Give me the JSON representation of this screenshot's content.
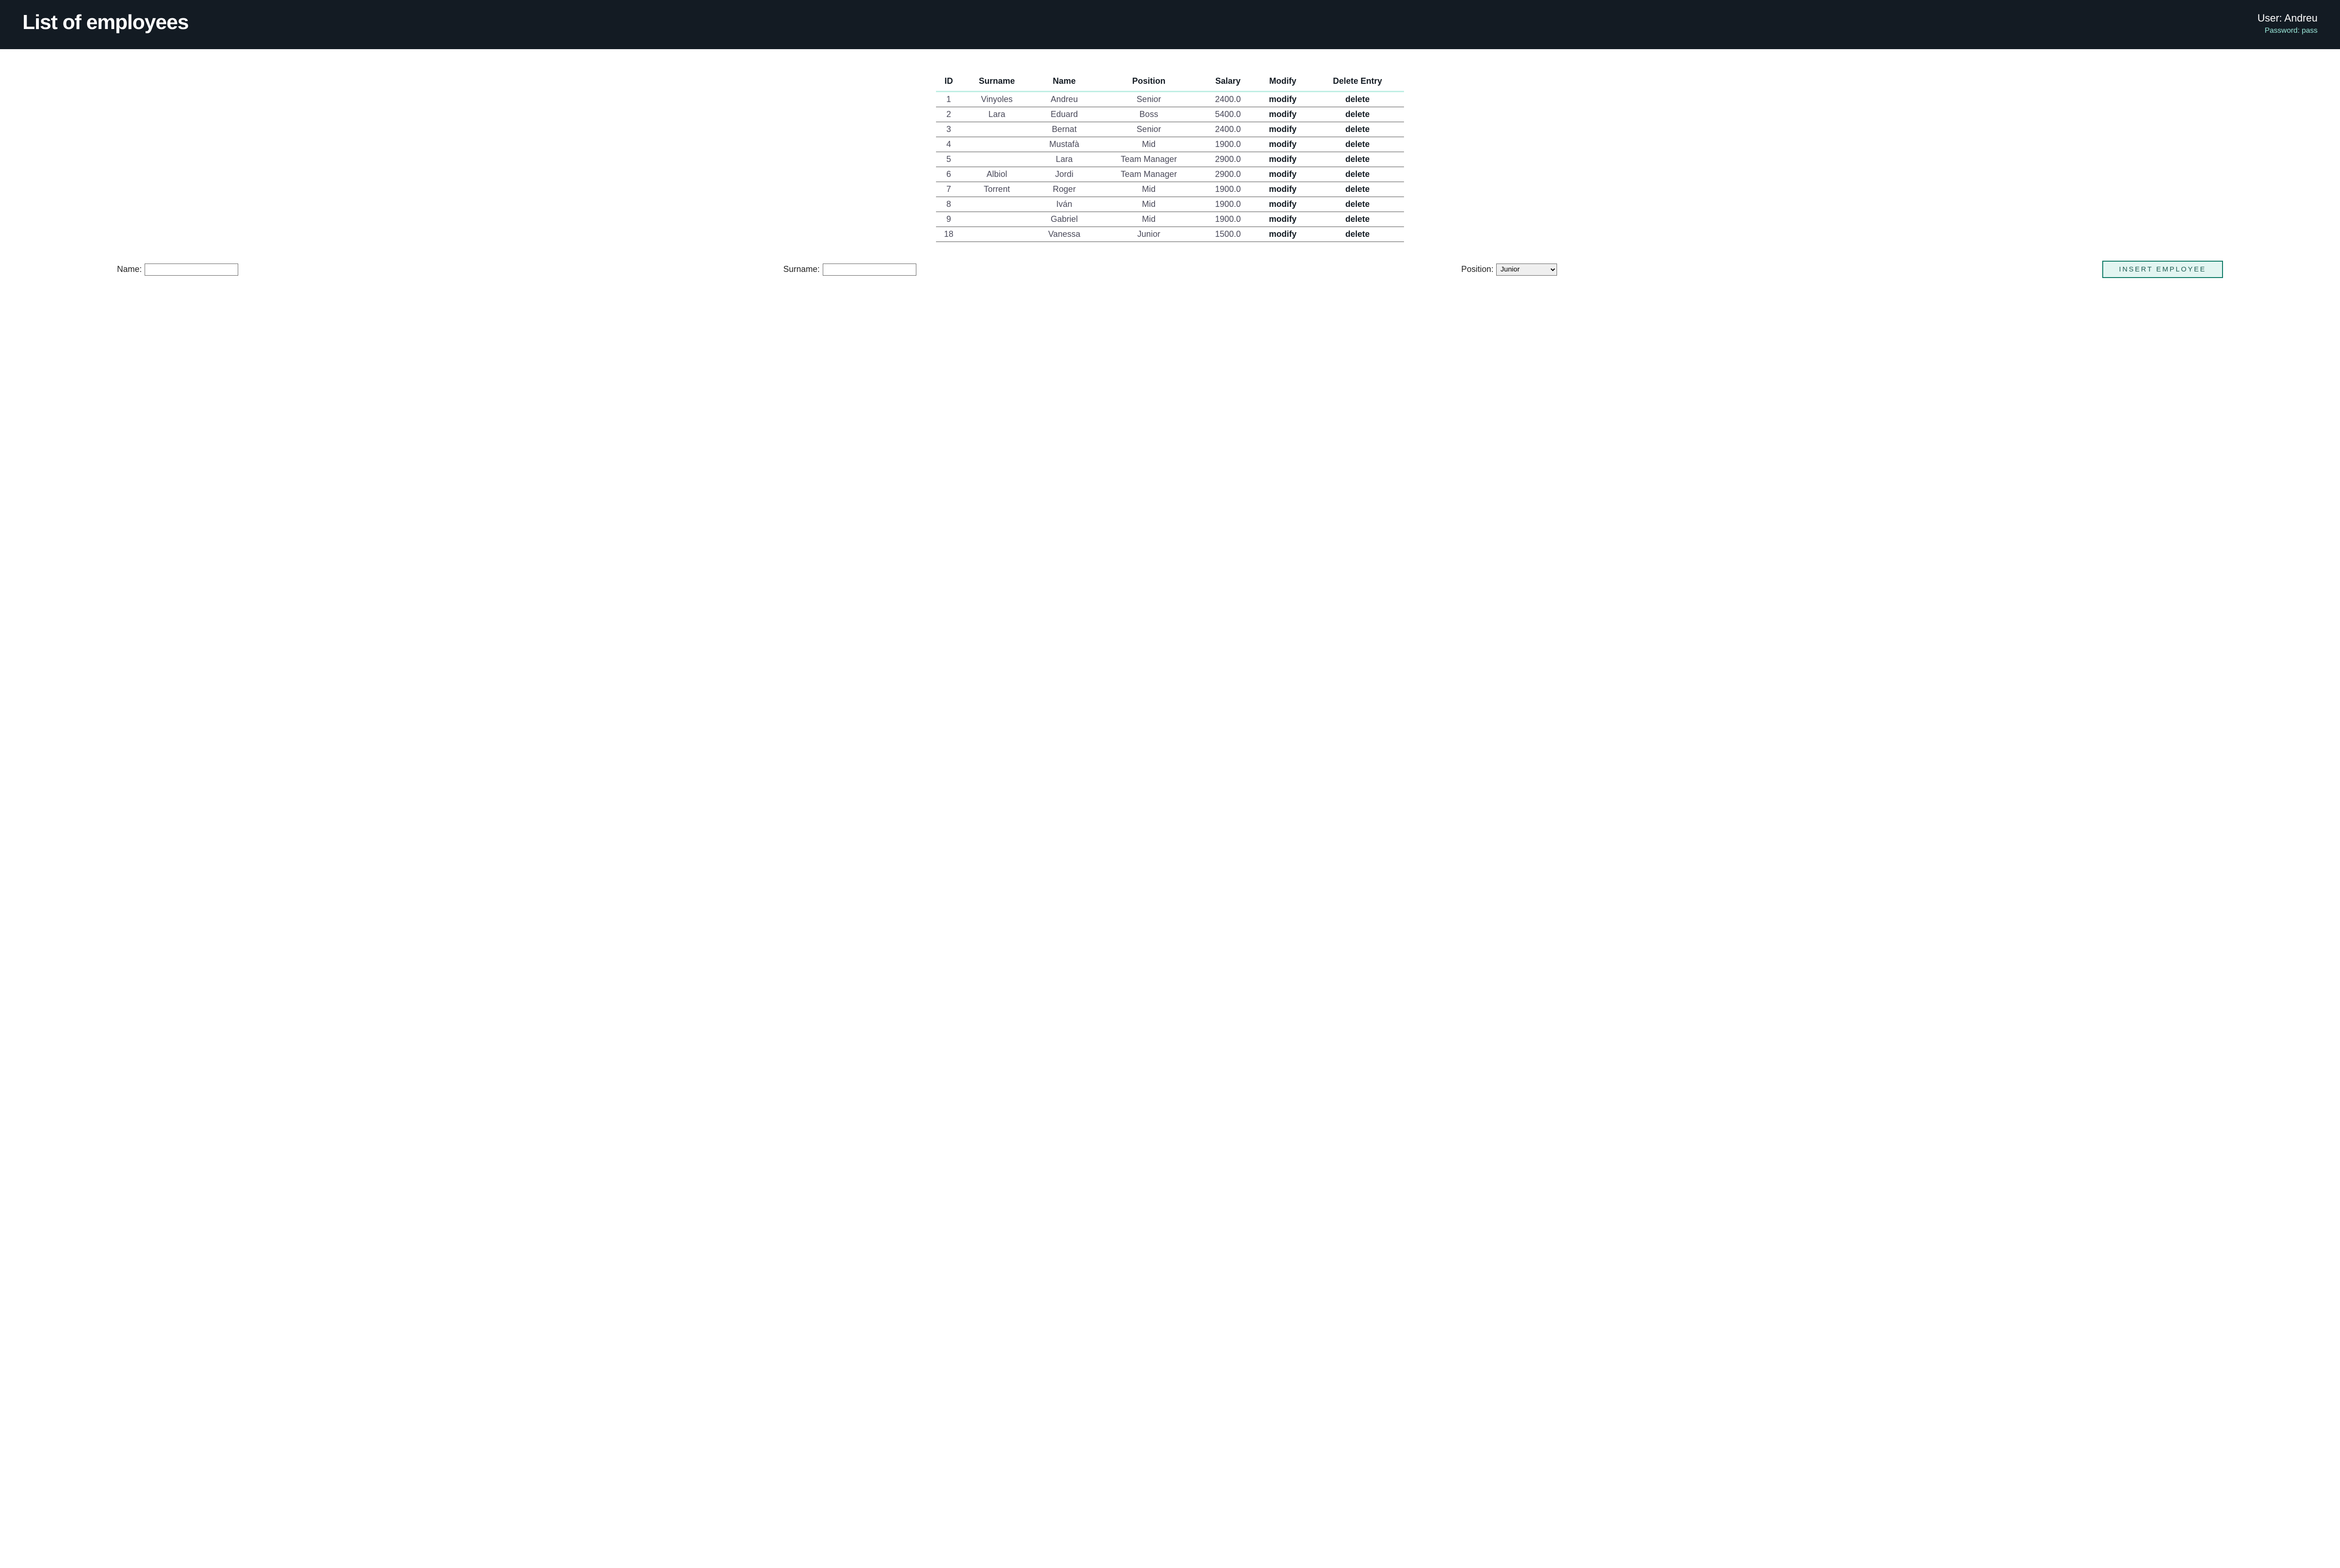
{
  "header": {
    "title": "List of employees",
    "user_label": "User: ",
    "user_name": "Andreu",
    "password_label": "Password: ",
    "password_value": "pass"
  },
  "table": {
    "headers": {
      "id": "ID",
      "surname": "Surname",
      "name": "Name",
      "position": "Position",
      "salary": "Salary",
      "modify": "Modify",
      "delete": "Delete Entry"
    },
    "modify_label": "modify",
    "delete_label": "delete",
    "rows": [
      {
        "id": "1",
        "surname": "Vinyoles",
        "name": "Andreu",
        "position": "Senior",
        "salary": "2400.0"
      },
      {
        "id": "2",
        "surname": "Lara",
        "name": "Eduard",
        "position": "Boss",
        "salary": "5400.0"
      },
      {
        "id": "3",
        "surname": "",
        "name": "Bernat",
        "position": "Senior",
        "salary": "2400.0"
      },
      {
        "id": "4",
        "surname": "",
        "name": "Mustafà",
        "position": "Mid",
        "salary": "1900.0"
      },
      {
        "id": "5",
        "surname": "",
        "name": "Lara",
        "position": "Team Manager",
        "salary": "2900.0"
      },
      {
        "id": "6",
        "surname": "Albiol",
        "name": "Jordi",
        "position": "Team Manager",
        "salary": "2900.0"
      },
      {
        "id": "7",
        "surname": "Torrent",
        "name": "Roger",
        "position": "Mid",
        "salary": "1900.0"
      },
      {
        "id": "8",
        "surname": "",
        "name": "Iván",
        "position": "Mid",
        "salary": "1900.0"
      },
      {
        "id": "9",
        "surname": "",
        "name": "Gabriel",
        "position": "Mid",
        "salary": "1900.0"
      },
      {
        "id": "18",
        "surname": "",
        "name": "Vanessa",
        "position": "Junior",
        "salary": "1500.0"
      }
    ]
  },
  "form": {
    "name_label": "Name:",
    "surname_label": "Surname:",
    "position_label": "Position:",
    "position_selected": "Junior",
    "insert_button": "INSERT EMPLOYEE"
  }
}
